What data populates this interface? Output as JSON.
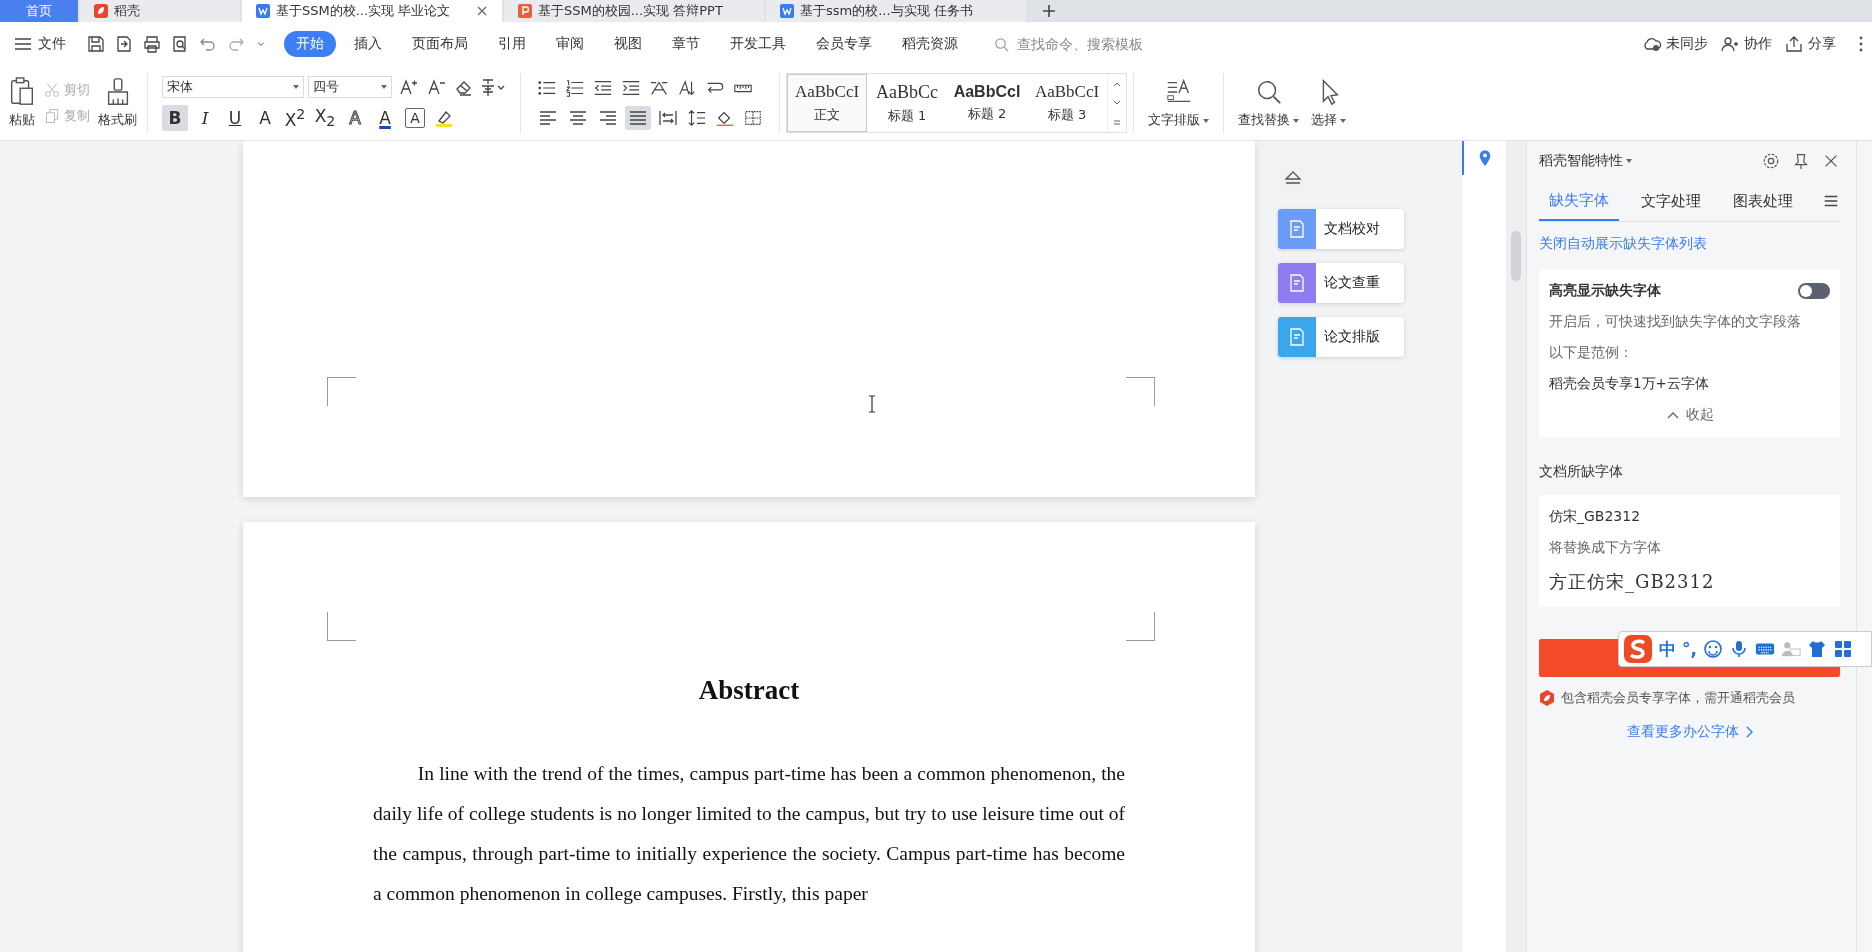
{
  "tabs": [
    {
      "label": "首页",
      "kind": "home",
      "selected": false
    },
    {
      "label": "稻壳",
      "kind": "daoke",
      "selected": false
    },
    {
      "label": "基于SSM的校...实现 毕业论文",
      "kind": "doc",
      "selected": true
    },
    {
      "label": "基于SSM的校园...实现 答辩PPT",
      "kind": "ppt",
      "selected": false
    },
    {
      "label": "基于ssm的校...与实现 任务书",
      "kind": "doc",
      "selected": false
    }
  ],
  "menu": {
    "file": "文件",
    "items": [
      {
        "label": "开始",
        "selected": true
      },
      {
        "label": "插入",
        "selected": false
      },
      {
        "label": "页面布局",
        "selected": false
      },
      {
        "label": "引用",
        "selected": false
      },
      {
        "label": "审阅",
        "selected": false
      },
      {
        "label": "视图",
        "selected": false
      },
      {
        "label": "章节",
        "selected": false
      },
      {
        "label": "开发工具",
        "selected": false
      },
      {
        "label": "会员专享",
        "selected": false
      },
      {
        "label": "稻壳资源",
        "selected": false
      }
    ],
    "search": {
      "placeholder": "查找命令、搜索模板"
    },
    "actions": [
      {
        "label": "未同步",
        "kind": "cloud"
      },
      {
        "label": "协作",
        "kind": "person"
      },
      {
        "label": "分享",
        "kind": "share"
      }
    ]
  },
  "ribbon": {
    "paste": "粘贴",
    "cut": {
      "label": "剪切",
      "disabled": true
    },
    "copy": {
      "label": "复制",
      "disabled": true
    },
    "format_painter": "格式刷",
    "font": {
      "name": "宋体",
      "size": "四号"
    },
    "format_buttons": [
      {
        "label": "B",
        "kind": "bold",
        "selected": true
      },
      {
        "label": "I",
        "kind": "italic",
        "selected": false
      },
      {
        "label": "U",
        "kind": "underline",
        "selected": false
      },
      {
        "label": "A",
        "kind": "strike",
        "selected": false
      },
      {
        "label": "X$^{2}$",
        "kind": "plain",
        "selected": false
      },
      {
        "label": "X$_{2}$",
        "kind": "plain",
        "selected": false
      },
      {
        "label": "A",
        "kind": "effect",
        "selected": false
      },
      {
        "label": "A",
        "kind": "color",
        "selected": false
      },
      {
        "label": "A",
        "kind": "border",
        "selected": false
      }
    ],
    "align": [
      {
        "kind": "left",
        "selected": false
      },
      {
        "kind": "center",
        "selected": false
      },
      {
        "kind": "right",
        "selected": false
      },
      {
        "kind": "justify",
        "selected": true
      },
      {
        "kind": "distributed",
        "selected": false
      }
    ],
    "styles": [
      {
        "sample": "AaBbCcI",
        "label": "正文",
        "kind": "serif",
        "selected": true
      },
      {
        "sample": "AaBbCc",
        "label": "标题 1",
        "kind": "serif-large",
        "selected": false
      },
      {
        "sample": "AaBbCcl",
        "label": "标题 2",
        "kind": "sans-bold",
        "selected": false
      },
      {
        "sample": "AaBbCcI",
        "label": "标题 3",
        "kind": "serif",
        "selected": false
      }
    ],
    "text_layout": "文字排版",
    "find_replace": "查找替换",
    "select": "选择"
  },
  "document": {
    "heading": "Abstract",
    "paragraph": "In line with the trend of the times, campus part-time has been a common phenomenon, the daily life of college students is no longer limited to the campus, but try to use leisure time out of the campus, through part-time to initially experience the society. Campus part-time has become a common phenomenon in college campuses. Firstly, this paper"
  },
  "floating_tools": [
    {
      "label": "文档校对",
      "color": "#6a9cf7"
    },
    {
      "label": "论文查重",
      "color": "#8e7cf2"
    },
    {
      "label": "论文排版",
      "color": "#3aa6ee"
    }
  ],
  "panel": {
    "title": "稻壳智能特性",
    "tabs": [
      {
        "label": "缺失字体",
        "selected": true
      },
      {
        "label": "文字处理",
        "selected": false
      },
      {
        "label": "图表处理",
        "selected": false
      }
    ],
    "close_link": "关闭自动展示缺失字体列表",
    "highlight": {
      "title": "高亮显示缺失字体",
      "on": false,
      "description": "开启后，可快速找到缺失字体的文字段落",
      "example_label": "以下是范例：",
      "example": "稻壳会员专享1万+云字体",
      "collapse": "收起"
    },
    "missing_title": "文档所缺字体",
    "missing_font": {
      "name": "仿宋_GB2312",
      "note": "将替换成下方字体",
      "replacement": "方正仿宋_GB2312"
    },
    "member_note": "包含稻壳会员专享字体，需开通稻壳会员",
    "more_link": "查看更多办公字体"
  },
  "ime_bar": {
    "mode": "中",
    "punct": "°,"
  }
}
